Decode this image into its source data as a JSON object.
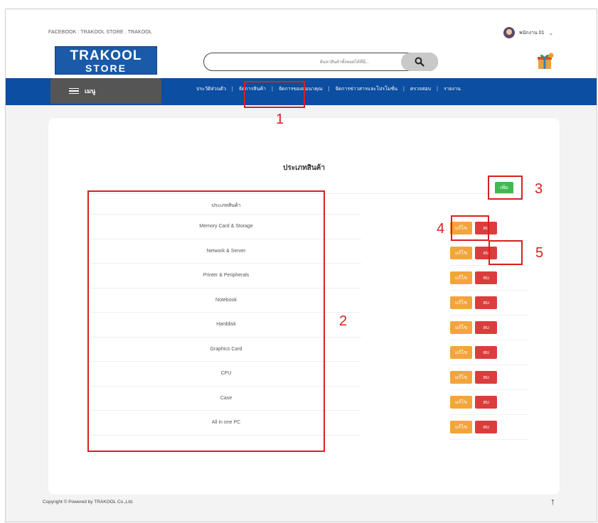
{
  "header": {
    "facebook_text": "FACEBOOK : TRAKOOL STORE . TRAKOOL",
    "user_name": "พนักงาน 01",
    "user_chevron": "⌄",
    "logo_line1": "TRAKOOL",
    "logo_line2": "STORE",
    "search_placeholder": "ค้นหาสินค้าทั้งหมดได้ที่นี่...",
    "search_icon": "search-icon",
    "gift_icon": "gift-icon"
  },
  "nav": {
    "menu_label": "เมนู",
    "items": [
      "ประวัติส่วนตัว",
      "จัดการสินค้า",
      "จัดการของสมนาคุณ",
      "จัดการข่าวสารและโปรโมชั่น",
      "ตรวจสอบ",
      "รายงาน"
    ],
    "separator": "|"
  },
  "main": {
    "title": "ประเภทสินค้า",
    "add_label": "เพิ่ม",
    "column_header": "ประเภทสินค้า",
    "rows": [
      "Memory Card & Storage",
      "Network & Server",
      "Printer & Peripherals",
      "Notebook",
      "Harddisk",
      "Graphics Card",
      "CPU",
      "Case",
      "All in one PC"
    ],
    "edit_label": "แก้ไข",
    "delete_label": "ลบ"
  },
  "footer": {
    "copyright": "Copyright © Powered by TRAKOOL Co.,Ltd.",
    "up_arrow": "↑"
  },
  "annotations": [
    "1",
    "2",
    "3",
    "4",
    "5"
  ],
  "colors": {
    "nav_blue": "#0b4ea2",
    "logo_blue": "#1a5aa8",
    "add_green": "#41b853",
    "edit_orange": "#f3a53c",
    "delete_red": "#db3d3d",
    "annotation_red": "#d91f1f"
  }
}
